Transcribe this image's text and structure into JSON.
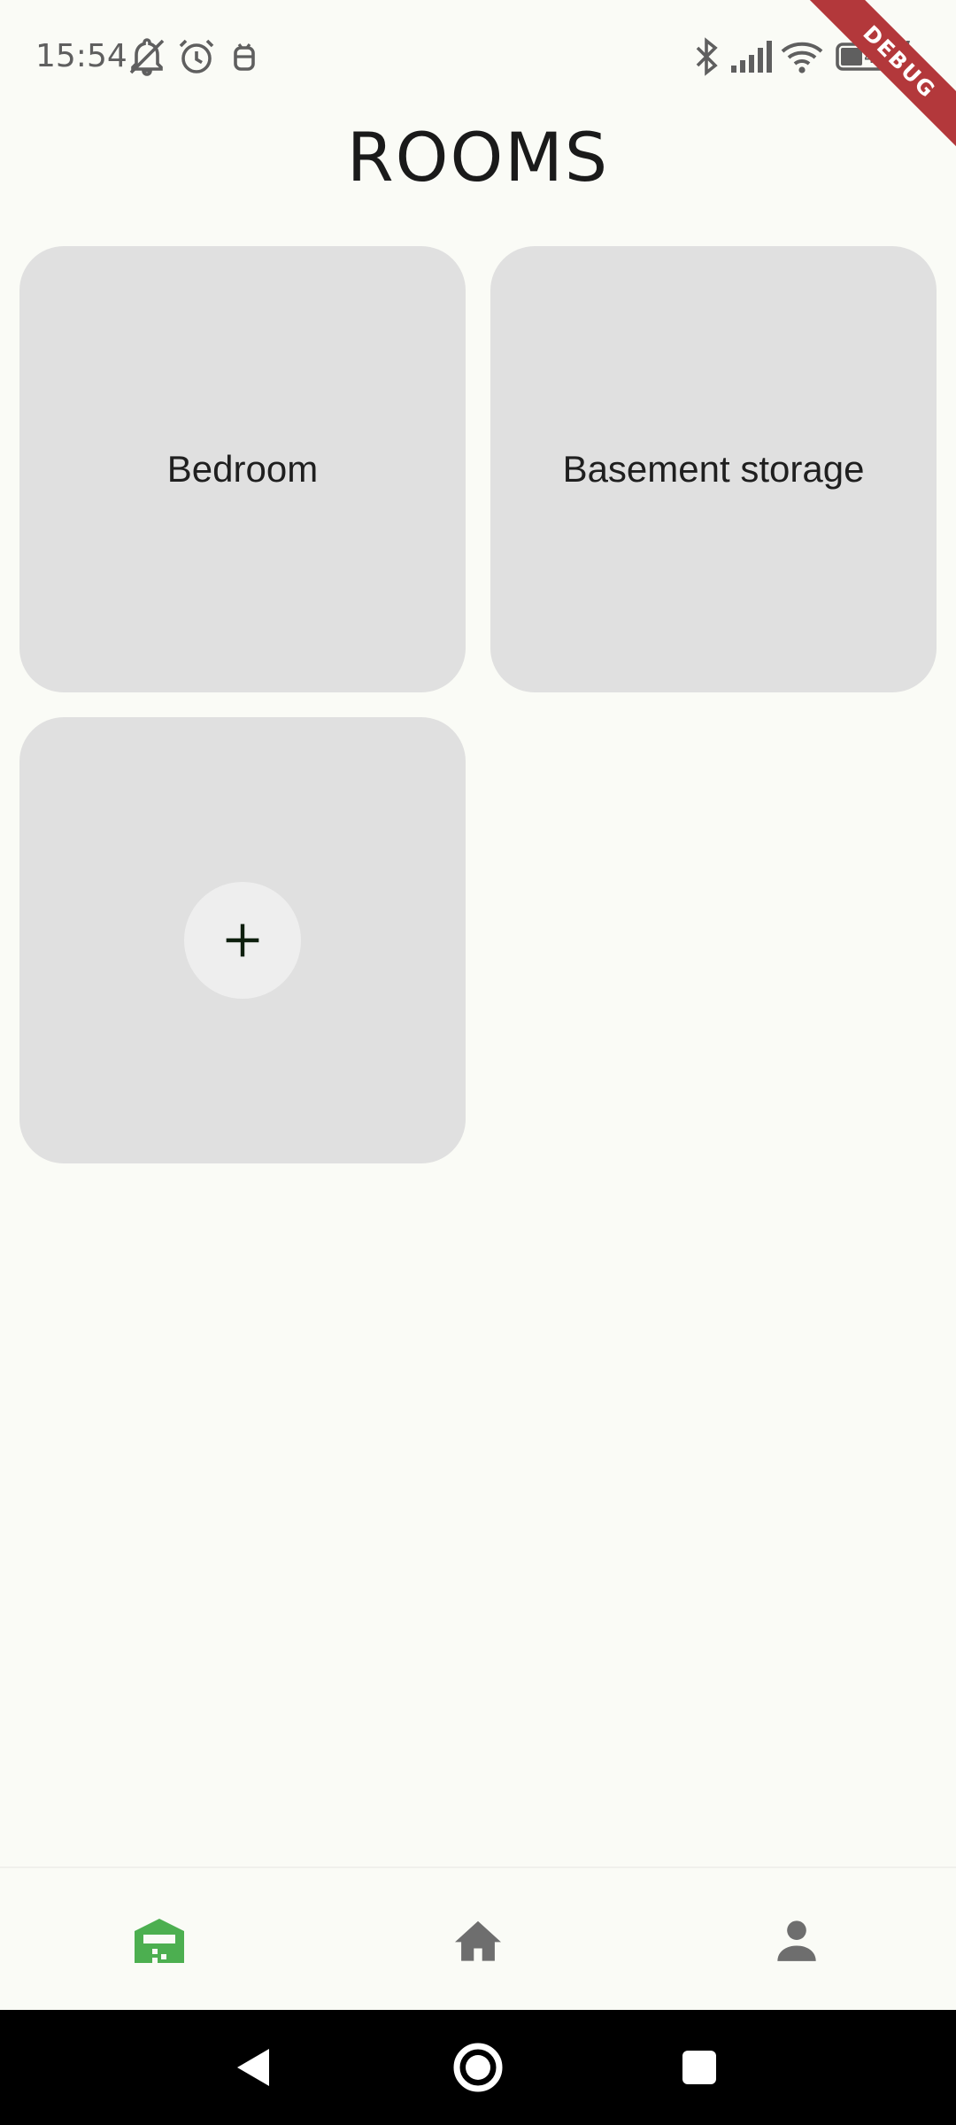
{
  "status_bar": {
    "time": "15:54",
    "battery_level": "45",
    "icons": [
      "notifications-off-icon",
      "alarm-icon",
      "vpn-robot-icon",
      "bluetooth-icon",
      "cellular-signal-icon",
      "wifi-icon",
      "battery-charging-icon"
    ]
  },
  "debug_banner": {
    "label": "DEBUG",
    "color": "#b3383b"
  },
  "page": {
    "title": "ROOMS"
  },
  "rooms": [
    {
      "label": "Bedroom"
    },
    {
      "label": "Basement storage"
    }
  ],
  "add_room": {
    "icon": "plus-icon"
  },
  "bottom_nav": {
    "active_color": "#4caf50",
    "inactive_color": "#6e6e6e",
    "items": [
      {
        "icon": "storage-garage-icon",
        "active": true
      },
      {
        "icon": "home-icon",
        "active": false
      },
      {
        "icon": "person-icon",
        "active": false
      }
    ]
  },
  "system_nav": {
    "buttons": [
      "back-icon",
      "home-circle-icon",
      "recents-icon"
    ]
  }
}
